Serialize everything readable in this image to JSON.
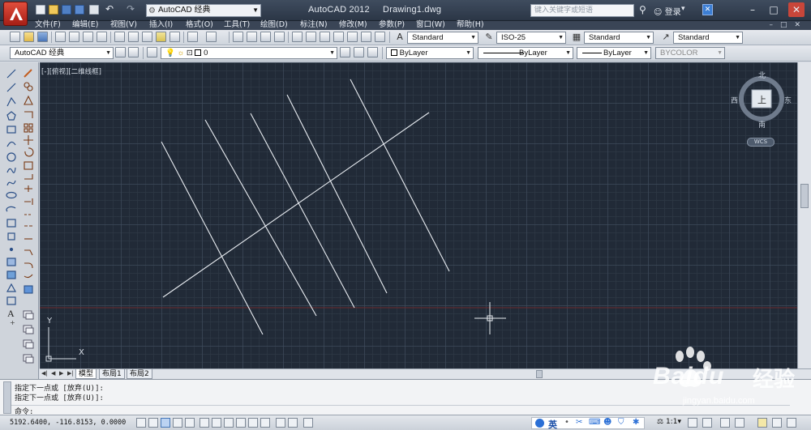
{
  "titlebar": {
    "workspace": "AutoCAD 经典",
    "title": "AutoCAD 2012     Drawing1.dwg",
    "search_placeholder": "键入关键字或短语",
    "login": "登录"
  },
  "menu": [
    "文件(F)",
    "编辑(E)",
    "视图(V)",
    "插入(I)",
    "格式(O)",
    "工具(T)",
    "绘图(D)",
    "标注(N)",
    "修改(M)",
    "参数(P)",
    "窗口(W)",
    "帮助(H)"
  ],
  "styles_toolbar": {
    "text_style": "Standard",
    "dim_style": "ISO-25",
    "table_style": "Standard",
    "mleader_style": "Standard"
  },
  "props_toolbar": {
    "workspace": "AutoCAD 经典",
    "layer": "0",
    "color": "ByLayer",
    "linetype": "ByLayer",
    "lineweight": "ByLayer",
    "plotstyle": "BYCOLOR"
  },
  "viewport_label": "[-][俯视][二维线框]",
  "viewcube": {
    "north": "北",
    "south": "南",
    "east": "东",
    "west": "西",
    "face": "上",
    "wcs": "WCS"
  },
  "ucs": {
    "x": "X",
    "y": "Y"
  },
  "tabs": [
    "模型",
    "布局1",
    "布局2"
  ],
  "command": {
    "history": [
      "指定下一点或 [放弃(U)]:",
      "指定下一点或 [放弃(U)]:"
    ],
    "prompt": "命令:"
  },
  "status": {
    "coords": "5192.6400, -116.8153, 0.0000",
    "ime": "英",
    "scale": "1:1"
  },
  "watermark": {
    "brand": "Baidu",
    "cn": "经验",
    "url": "jingyan.baidu.com"
  },
  "colors": {
    "canvas": "#212a37",
    "lines": "#e8ecf0",
    "axis_red": "#7a2b2b"
  }
}
